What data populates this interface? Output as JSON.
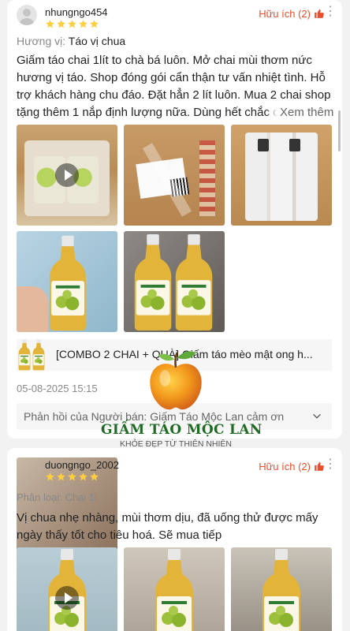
{
  "reviews": [
    {
      "username": "nhungngo454",
      "stars": 5,
      "helpful_label": "Hữu ích (2)",
      "variant_label": "Hương vị:",
      "variant_value": "Táo vị chua",
      "body": "Giấm táo chai 1lít to chà bá luôn. Mở chai mùi thơm nức hương vị táo. Shop đóng gói cẩn thận tư vấn nhiệt tình. Hỗ trợ khách hàng chu đáo. Đặt hẳn 2 lít luôn. Mua 2 chai shop tặng thêm 1 nắp định lượng nữa. Dùng hết chắc c",
      "see_more": "Xem thêm",
      "product_name": "[COMBO 2 CHAI + QUÀ] Giấm táo mèo mật ong h...",
      "date": "05-08-2025 15:15",
      "reply": "Phản hồi của Người bán: Giấm Táo Mộc Lan cảm ơn"
    },
    {
      "username": "duongngo_2002",
      "stars": 5,
      "helpful_label": "Hữu ích (2)",
      "variant_label": "Phân loại:",
      "variant_value": "Chai 1l",
      "body": "Vị chua nhẹ nhàng, mùi thơm dịu, đã uống thử được mấy ngày thấy tốt cho tiêu hoá. Sẽ mua tiếp"
    }
  ],
  "watermark": {
    "title": "GIẤM TÁO MỘC LAN",
    "subtitle": "KHỎE ĐẸP TỪ THIÊN NHIÊN"
  },
  "colors": {
    "accent": "#ee4d2d",
    "star": "#ffce3d",
    "brand_green": "#1f6b24"
  }
}
